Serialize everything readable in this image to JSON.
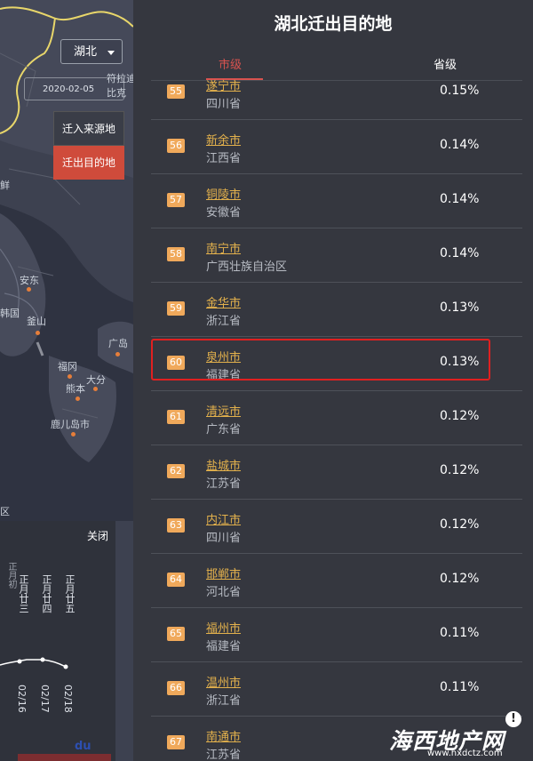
{
  "map": {
    "province": "湖北",
    "date": "2020-02-05",
    "in_button": "迁入来源地",
    "out_button": "迁出目的地",
    "edge_labels": [
      "符拉迪",
      "比克"
    ],
    "city_labels": [
      "安东",
      "韩国",
      "釜山",
      "广岛",
      "福冈",
      "熊本",
      "大分",
      "鹿儿岛市"
    ],
    "left_edge_labels": [
      "鲜",
      "区"
    ],
    "colors": {
      "land": "#3d4150",
      "sea": "#2d3140",
      "border": "#e8d66a",
      "out_button": "#cf4b3b",
      "dot": "#e67e3a"
    }
  },
  "trend": {
    "close": "关闭",
    "top_partial": "正月初",
    "lunar_labels": [
      "正月廿三",
      "正月廿四",
      "正月廿五"
    ],
    "date_labels": [
      "02/16",
      "02/17",
      "02/18"
    ],
    "logo": "du"
  },
  "panel": {
    "title": "湖北迁出目的地",
    "tab_city": "市级",
    "tab_province": "省级",
    "rows": [
      {
        "rank": "55",
        "city": "遂宁市",
        "province": "四川省",
        "pct": "0.15%"
      },
      {
        "rank": "56",
        "city": "新余市",
        "province": "江西省",
        "pct": "0.14%"
      },
      {
        "rank": "57",
        "city": "铜陵市",
        "province": "安徽省",
        "pct": "0.14%"
      },
      {
        "rank": "58",
        "city": "南宁市",
        "province": "广西壮族自治区",
        "pct": "0.14%"
      },
      {
        "rank": "59",
        "city": "金华市",
        "province": "浙江省",
        "pct": "0.13%"
      },
      {
        "rank": "60",
        "city": "泉州市",
        "province": "福建省",
        "pct": "0.13%"
      },
      {
        "rank": "61",
        "city": "清远市",
        "province": "广东省",
        "pct": "0.12%"
      },
      {
        "rank": "62",
        "city": "盐城市",
        "province": "江苏省",
        "pct": "0.12%"
      },
      {
        "rank": "63",
        "city": "内江市",
        "province": "四川省",
        "pct": "0.12%"
      },
      {
        "rank": "64",
        "city": "邯郸市",
        "province": "河北省",
        "pct": "0.12%"
      },
      {
        "rank": "65",
        "city": "福州市",
        "province": "福建省",
        "pct": "0.11%"
      },
      {
        "rank": "66",
        "city": "温州市",
        "province": "浙江省",
        "pct": "0.11%"
      },
      {
        "rank": "67",
        "city": "南通市",
        "province": "江苏省",
        "pct": ""
      }
    ],
    "colors": {
      "rank_badge": "#f0a95b",
      "city": "#e3b14c",
      "tab_active": "#d9534f",
      "highlight": "#e02020"
    }
  },
  "watermark": {
    "text": "海西地产网",
    "url": "www.hxdctz.com",
    "icon": "!"
  }
}
